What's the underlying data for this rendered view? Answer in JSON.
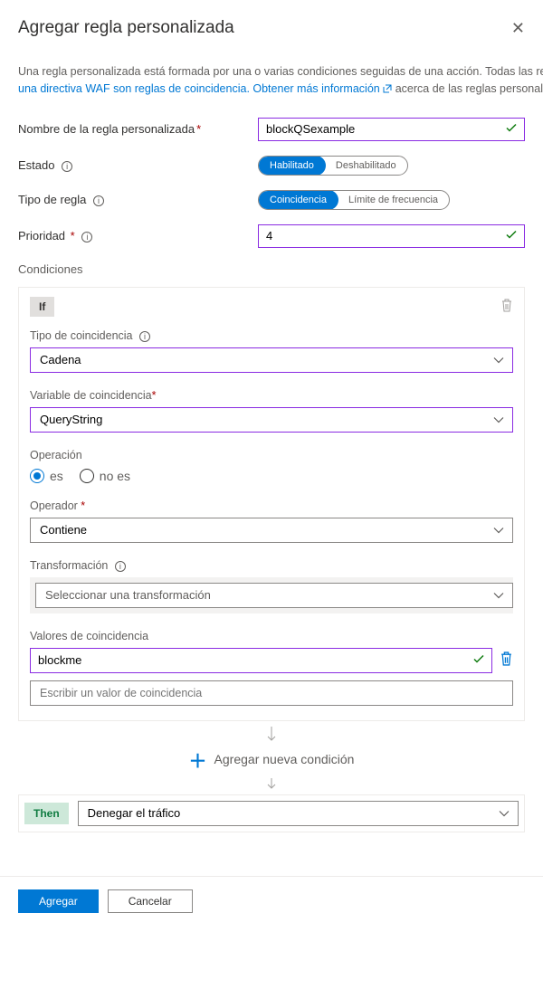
{
  "header": {
    "title": "Agregar regla personalizada"
  },
  "intro": {
    "line1": "Una regla personalizada está formada por una o varias condiciones seguidas de una acción. Todas las reglas personalizadas de",
    "line2_link": "una directiva WAF son reglas de coincidencia. Obtener más información",
    "line2_rest": " acerca de las reglas personalizadas."
  },
  "fields": {
    "name": {
      "label": "Nombre de la regla personalizada",
      "value": "blockQSexample"
    },
    "status": {
      "label": "Estado",
      "opt_enabled": "Habilitado",
      "opt_disabled": "Deshabilitado"
    },
    "ruletype": {
      "label": "Tipo de regla",
      "opt_match": "Coincidencia",
      "opt_rate": "Límite de frecuencia"
    },
    "priority": {
      "label": "Prioridad",
      "value": "4"
    }
  },
  "conditions": {
    "title": "Condiciones",
    "if_tag": "If",
    "match_type": {
      "label": "Tipo de coincidencia",
      "value": "Cadena"
    },
    "match_var": {
      "label": "Variable de coincidencia",
      "value": "QueryString"
    },
    "operation": {
      "label": "Operación",
      "opt_is": "es",
      "opt_isnot": "no es"
    },
    "operator": {
      "label": "Operador",
      "value": "Contiene"
    },
    "transform": {
      "label": "Transformación",
      "placeholder": "Seleccionar una transformación"
    },
    "match_values": {
      "label": "Valores de coincidencia",
      "value0": "blockme",
      "placeholder": "Escribir un valor de coincidencia"
    },
    "add_condition": "Agregar nueva condición"
  },
  "then": {
    "tag": "Then",
    "value": "Denegar el tráfico"
  },
  "footer": {
    "add": "Agregar",
    "cancel": "Cancelar"
  }
}
